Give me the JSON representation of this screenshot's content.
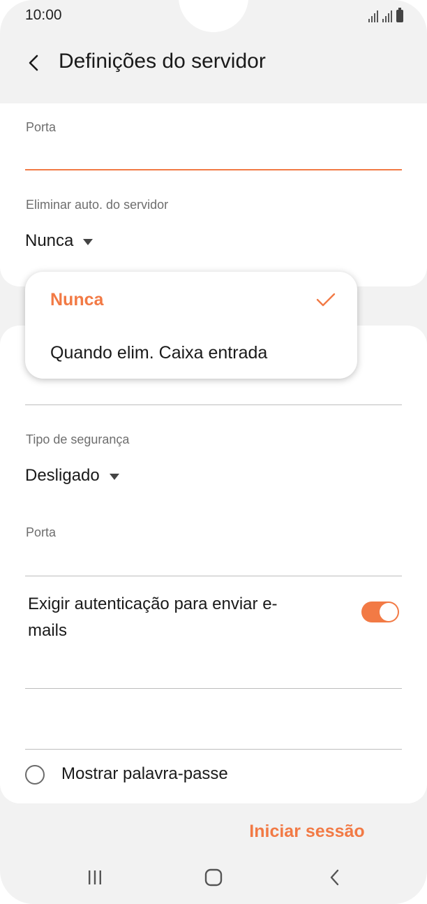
{
  "status_bar": {
    "time": "10:00"
  },
  "header": {
    "title": "Definições do servidor"
  },
  "incoming": {
    "port_label": "Porta",
    "port_value": "",
    "delete_label": "Eliminar auto. do servidor",
    "delete_value": "Nunca"
  },
  "dropdown_menu": {
    "options": [
      {
        "label": "Nunca",
        "selected": true
      },
      {
        "label": "Quando elim. Caixa entrada",
        "selected": false
      }
    ]
  },
  "outgoing": {
    "security_label": "Tipo de segurança",
    "security_value": "Desligado",
    "port_label": "Porta",
    "port_value": "",
    "auth_label": "Exigir autenticação para enviar e-mails",
    "auth_enabled": true
  },
  "show_password": {
    "label": "Mostrar palavra-passe",
    "checked": false
  },
  "actions": {
    "login_label": "Iniciar sessão"
  },
  "colors": {
    "accent": "#f27a45",
    "background": "#f2f2f2",
    "card": "#ffffff"
  }
}
